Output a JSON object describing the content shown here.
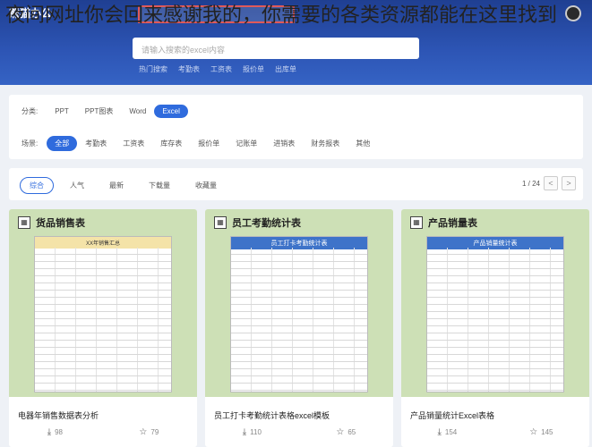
{
  "header": {
    "logo": "熊猫办公",
    "search_placeholder": "请输入搜索的excel内容",
    "nav": [
      "热门搜索",
      "考勤表",
      "工资表",
      "报价单",
      "出库单"
    ]
  },
  "overlay": {
    "text": "夜间网址你会回来感谢我的，你需要的各类资源都能在这里找到"
  },
  "filters": {
    "category_label": "分类:",
    "categories": [
      "PPT",
      "PPT图表",
      "Word",
      "Excel"
    ],
    "scene_label": "场景:",
    "scenes": [
      "全部",
      "考勤表",
      "工资表",
      "库存表",
      "报价单",
      "记账单",
      "进销表",
      "财务报表",
      "其他"
    ]
  },
  "sort": {
    "options": [
      "综合",
      "人气",
      "最新",
      "下载量",
      "收藏量"
    ],
    "page": "1 / 24",
    "prev": "<",
    "next": ">"
  },
  "cards": [
    {
      "category": "货品销售表",
      "title": "电器年销售数据表分析",
      "downloads": "98",
      "favorites": "79",
      "sheet_title": "XX年销售汇总"
    },
    {
      "category": "员工考勤统计表",
      "title": "员工打卡考勤统计表格excel模板",
      "downloads": "110",
      "favorites": "65",
      "sheet_title": "员工打卡考勤统计表"
    },
    {
      "category": "产品销量表",
      "title": "产品销量统计Excel表格",
      "downloads": "154",
      "favorites": "145",
      "sheet_title": "产品销量统计表"
    }
  ],
  "colors": {
    "accent": "#2f6bdd",
    "header": "#2d55b5",
    "thumb": "#cde0b6"
  },
  "icons": {
    "download": "download-icon",
    "favorite": "star-icon"
  }
}
